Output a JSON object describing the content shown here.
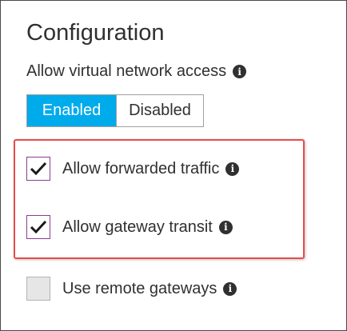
{
  "panel": {
    "title": "Configuration"
  },
  "network_access": {
    "label": "Allow virtual network access",
    "info_icon": "info-icon",
    "options": [
      "Enabled",
      "Disabled"
    ],
    "selected": "Enabled"
  },
  "checkboxes": [
    {
      "label": "Allow forwarded traffic",
      "checked": true
    },
    {
      "label": "Allow gateway transit",
      "checked": true
    },
    {
      "label": "Use remote gateways",
      "checked": false
    }
  ],
  "colors": {
    "accent": "#00abec",
    "highlight_border": "#e84b4b",
    "checkbox_border": "#8a3d8f",
    "text": "#303030"
  }
}
